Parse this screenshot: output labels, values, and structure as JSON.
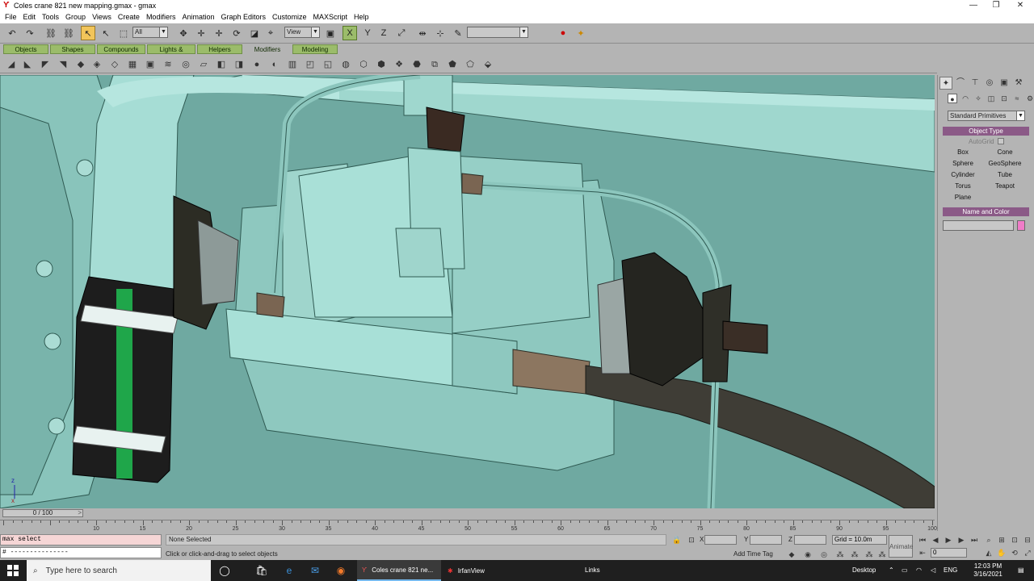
{
  "window": {
    "title": "Coles crane 821 new mapping.gmax - gmax",
    "controls": [
      "—",
      "❐",
      "✕"
    ]
  },
  "menu": [
    "File",
    "Edit",
    "Tools",
    "Group",
    "Views",
    "Create",
    "Modifiers",
    "Animation",
    "Graph Editors",
    "Customize",
    "MAXScript",
    "Help"
  ],
  "toolbar": {
    "selection_filter": "All",
    "ref_coord": "View",
    "named_selection": ""
  },
  "tabs": [
    "Objects",
    "Shapes",
    "Compounds",
    "Lights & Cameras",
    "Helpers",
    "Modifiers",
    "Modeling"
  ],
  "active_tab": "Modifiers",
  "command_panel": {
    "category": "Standard Primitives",
    "object_type_header": "Object Type",
    "autogrid_label": "AutoGrid",
    "primitives": [
      "Box",
      "Cone",
      "Sphere",
      "GeoSphere",
      "Cylinder",
      "Tube",
      "Torus",
      "Teapot",
      "Plane"
    ],
    "name_color_header": "Name and Color",
    "name_value": "",
    "color": "#f07cc8"
  },
  "timeline": {
    "slider_label": "0 / 100",
    "ticks": [
      "10",
      "15",
      "20",
      "25",
      "30",
      "35",
      "40",
      "45",
      "50",
      "55",
      "60",
      "65",
      "70",
      "75",
      "80",
      "85",
      "90",
      "95",
      "100"
    ]
  },
  "status": {
    "maxscript_line1": "max select",
    "maxscript_line2": "# ---------------",
    "selection": "None Selected",
    "prompt": "Click or click-and-drag to select objects",
    "x_label": "X",
    "y_label": "Y",
    "z_label": "Z",
    "grid": "Grid = 10.0m",
    "add_time_tag": "Add Time Tag",
    "animate": "Animate",
    "frame": "0"
  },
  "taskbar": {
    "search_placeholder": "Type here to search",
    "task1": "Coles crane 821 ne...",
    "task2": "IrfanView",
    "links": "Links",
    "desktop": "Desktop",
    "lang": "ENG",
    "time": "12:03 PM",
    "date": "3/16/2021"
  }
}
